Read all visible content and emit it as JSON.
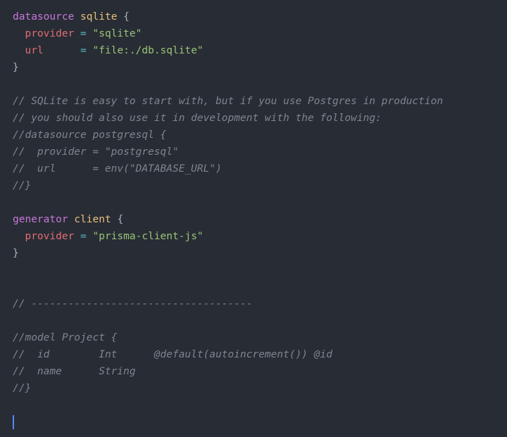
{
  "lines": {
    "l1_kw": "datasource",
    "l1_ident": "sqlite",
    "l1_brace": "{",
    "l2_prop": "provider",
    "l2_eq": "=",
    "l2_str": "\"sqlite\"",
    "l3_prop": "url",
    "l3_eq": "=",
    "l3_str": "\"file:./db.sqlite\"",
    "l4_brace": "}",
    "l6_comment": "// SQLite is easy to start with, but if you use Postgres in production",
    "l7_comment": "// you should also use it in development with the following:",
    "l8_comment": "//datasource postgresql {",
    "l9_comment": "//  provider = \"postgresql\"",
    "l10_comment": "//  url      = env(\"DATABASE_URL\")",
    "l11_comment": "//}",
    "l13_kw": "generator",
    "l13_ident": "client",
    "l13_brace": "{",
    "l14_prop": "provider",
    "l14_eq": "=",
    "l14_str": "\"prisma-client-js\"",
    "l15_brace": "}",
    "l18_comment": "// ------------------------------------",
    "l20_comment": "//model Project {",
    "l21_comment": "//  id        Int      @default(autoincrement()) @id",
    "l22_comment": "//  name      String",
    "l23_comment": "//}"
  }
}
